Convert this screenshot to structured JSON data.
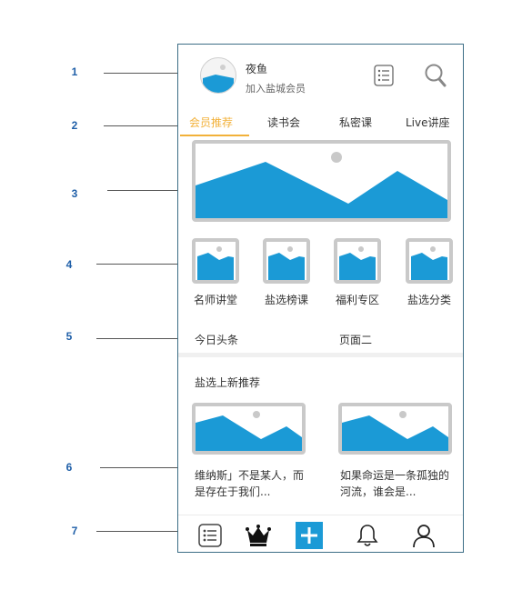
{
  "callouts": [
    "1",
    "2",
    "3",
    "4",
    "5",
    "6",
    "7"
  ],
  "profile": {
    "name": "夜鱼",
    "subtitle": "加入盐城会员"
  },
  "tabs": [
    {
      "label": "会员推荐",
      "active": true
    },
    {
      "label": "读书会"
    },
    {
      "label": "私密课"
    },
    {
      "label": "Live讲座"
    }
  ],
  "grid": [
    {
      "label": "名师讲堂"
    },
    {
      "label": "盐选榜课"
    },
    {
      "label": "福利专区"
    },
    {
      "label": "盐选分类"
    }
  ],
  "section_links": {
    "left": "今日头条",
    "right": "页面二"
  },
  "recommend": {
    "title": "盐选上新推荐",
    "cards": [
      {
        "text": "维纳斯」不是某人，而是存在于我们..."
      },
      {
        "text": "如果命运是一条孤独的河流，谁会是..."
      }
    ]
  },
  "bottom_nav": [
    "list-icon",
    "crown-icon",
    "plus-icon",
    "bell-icon",
    "user-icon"
  ],
  "colors": {
    "accent": "#f2b13a",
    "image_blue": "#1b9ad6",
    "frame_gray": "#c9c9c9",
    "callout_blue": "#1f5fa8"
  }
}
